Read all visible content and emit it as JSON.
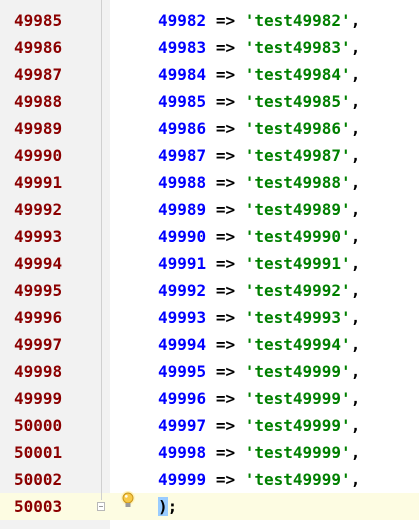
{
  "lines": [
    {
      "ln": "49985",
      "key": "49982",
      "op": "=>",
      "str": "'test49982'",
      "punc": ","
    },
    {
      "ln": "49986",
      "key": "49983",
      "op": "=>",
      "str": "'test49983'",
      "punc": ","
    },
    {
      "ln": "49987",
      "key": "49984",
      "op": "=>",
      "str": "'test49984'",
      "punc": ","
    },
    {
      "ln": "49988",
      "key": "49985",
      "op": "=>",
      "str": "'test49985'",
      "punc": ","
    },
    {
      "ln": "49989",
      "key": "49986",
      "op": "=>",
      "str": "'test49986'",
      "punc": ","
    },
    {
      "ln": "49990",
      "key": "49987",
      "op": "=>",
      "str": "'test49987'",
      "punc": ","
    },
    {
      "ln": "49991",
      "key": "49988",
      "op": "=>",
      "str": "'test49988'",
      "punc": ","
    },
    {
      "ln": "49992",
      "key": "49989",
      "op": "=>",
      "str": "'test49989'",
      "punc": ","
    },
    {
      "ln": "49993",
      "key": "49990",
      "op": "=>",
      "str": "'test49990'",
      "punc": ","
    },
    {
      "ln": "49994",
      "key": "49991",
      "op": "=>",
      "str": "'test49991'",
      "punc": ","
    },
    {
      "ln": "49995",
      "key": "49992",
      "op": "=>",
      "str": "'test49992'",
      "punc": ","
    },
    {
      "ln": "49996",
      "key": "49993",
      "op": "=>",
      "str": "'test49993'",
      "punc": ","
    },
    {
      "ln": "49997",
      "key": "49994",
      "op": "=>",
      "str": "'test49994'",
      "punc": ","
    },
    {
      "ln": "49998",
      "key": "49995",
      "op": "=>",
      "str": "'test49999'",
      "punc": ","
    },
    {
      "ln": "49999",
      "key": "49996",
      "op": "=>",
      "str": "'test49999'",
      "punc": ","
    },
    {
      "ln": "50000",
      "key": "49997",
      "op": "=>",
      "str": "'test49999'",
      "punc": ","
    },
    {
      "ln": "50001",
      "key": "49998",
      "op": "=>",
      "str": "'test49999'",
      "punc": ","
    },
    {
      "ln": "50002",
      "key": "49999",
      "op": "=>",
      "str": "'test49999'",
      "punc": ","
    }
  ],
  "last_line": {
    "ln": "50003",
    "paren": ")",
    "semicolon": ";"
  },
  "icons": {
    "intention": "lightbulb-icon",
    "fold": "fold-marker-icon"
  },
  "colors": {
    "line_number": "#8b0000",
    "number": "#0000ff",
    "string": "#008000",
    "current_line": "#fdfce2",
    "gutter": "#f2f2f2",
    "paren_highlight": "#99ccff"
  }
}
